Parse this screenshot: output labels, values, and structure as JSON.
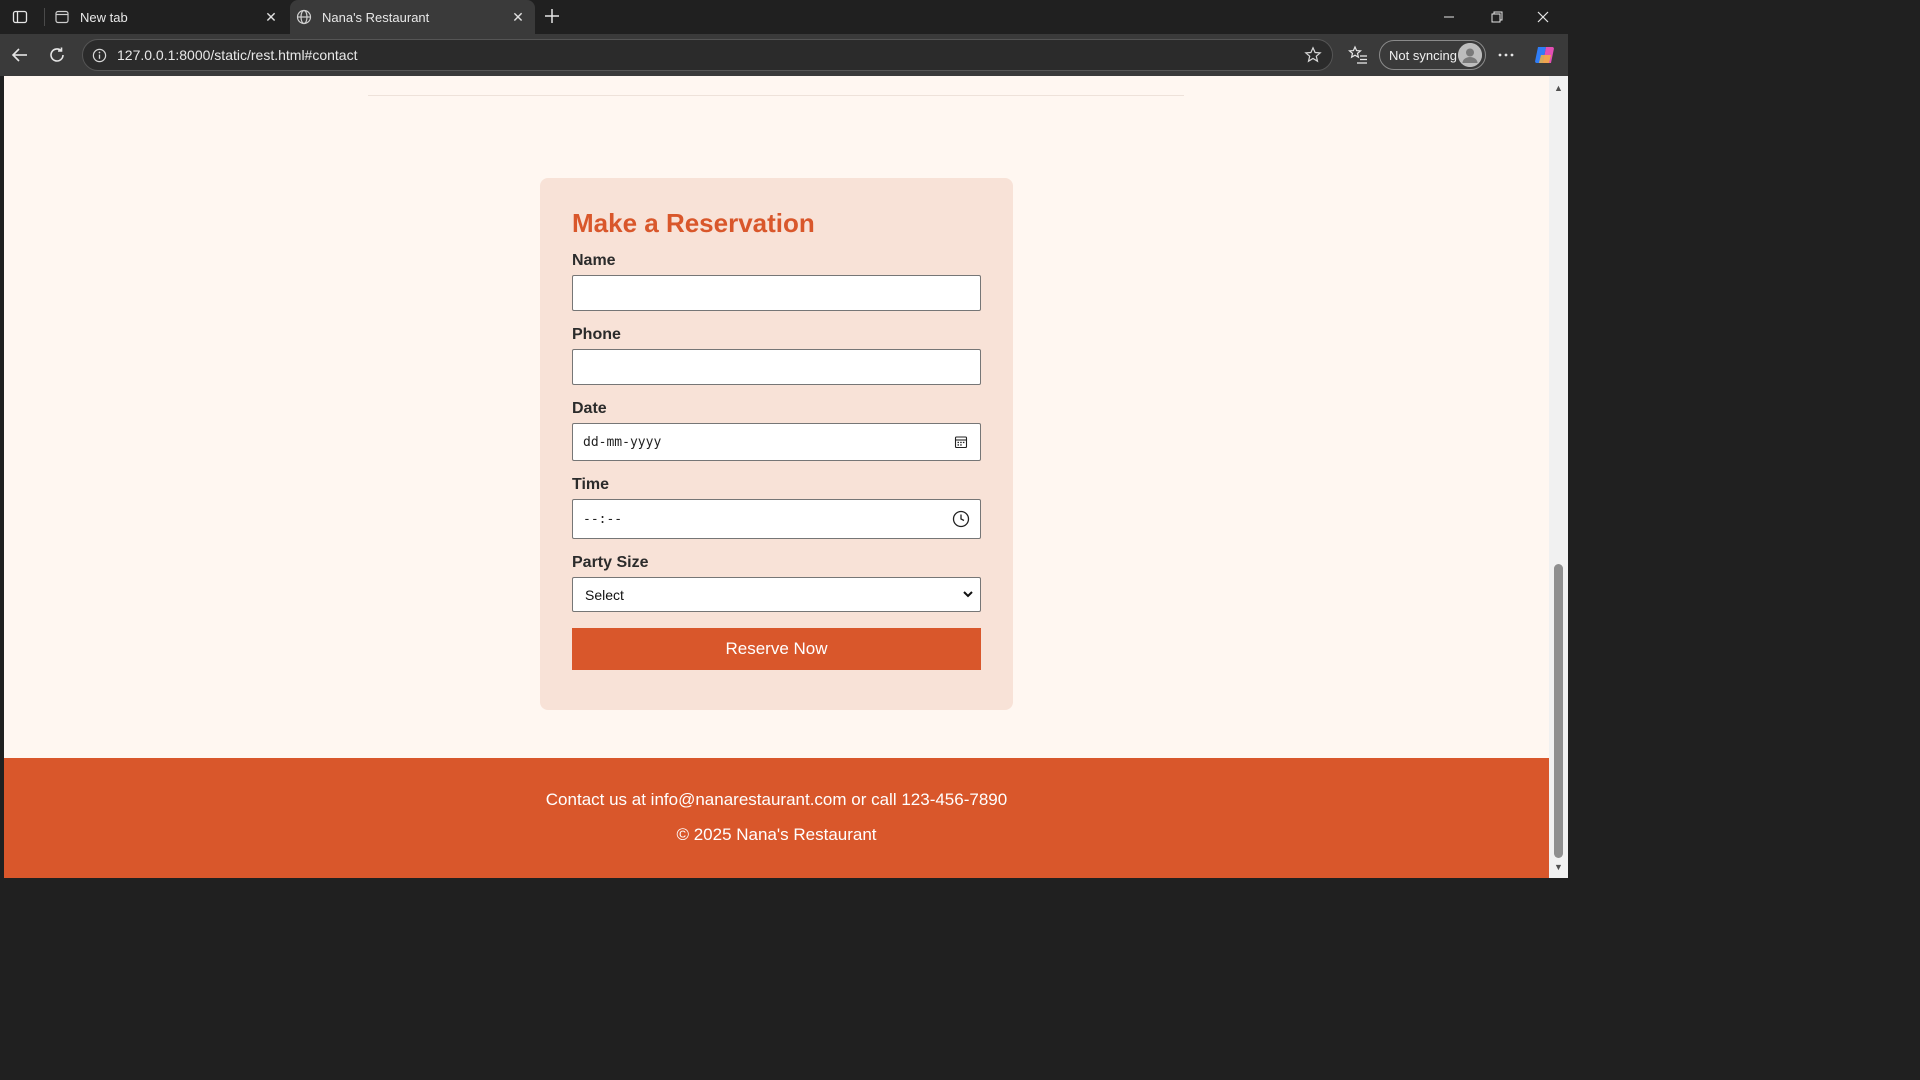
{
  "browser": {
    "tabs": [
      {
        "title": "New tab",
        "icon": "new-tab-page-icon",
        "active": false
      },
      {
        "title": "Nana's Restaurant",
        "icon": "globe-icon",
        "active": true
      }
    ],
    "url": "127.0.0.1:8000/static/rest.html#contact",
    "sync_status": "Not syncing"
  },
  "form": {
    "title": "Make a Reservation",
    "name_label": "Name",
    "name_value": "",
    "phone_label": "Phone",
    "phone_value": "",
    "date_label": "Date",
    "date_placeholder": "dd-mm-yyyy",
    "time_label": "Time",
    "time_placeholder": "--:--",
    "party_label": "Party Size",
    "party_selected": "Select",
    "submit_label": "Reserve Now"
  },
  "footer": {
    "contact_text": "Contact us at info@nanarestaurant.com or call 123-456-7890",
    "copyright": "© 2025 Nana's Restaurant"
  },
  "colors": {
    "accent": "#d9572b",
    "card_bg": "#f8e2d7",
    "page_bg": "#fff7f1"
  }
}
